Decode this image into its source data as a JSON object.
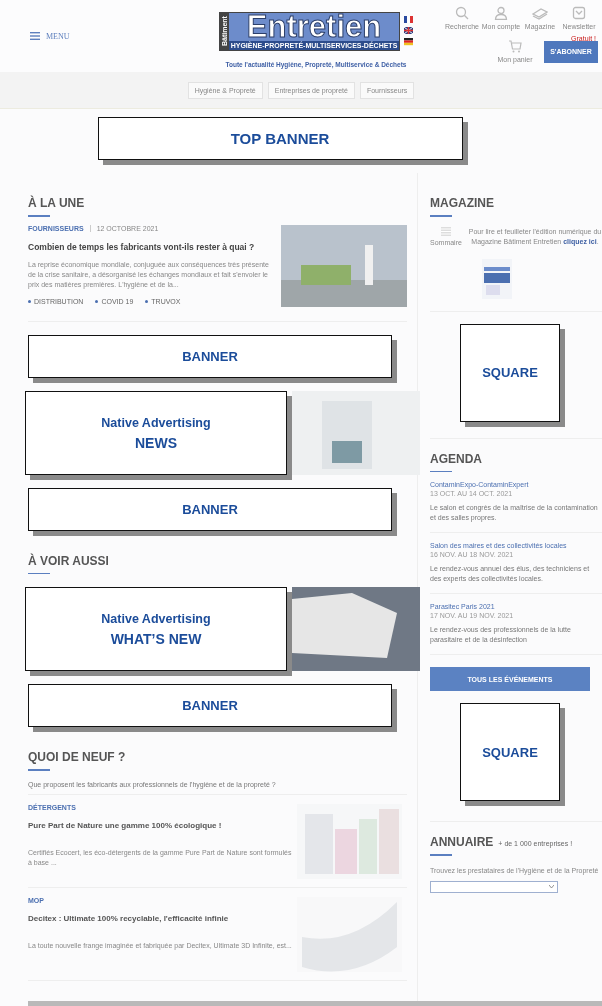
{
  "header": {
    "menu_label": "MENU",
    "logo": {
      "side_text": "Bâtiment",
      "title": "Entretien",
      "subtitle": "HYGIÈNE-PROPRETÉ-MULTISERVICES-DÉCHETS"
    },
    "tagline": "Toute l'actualité Hygiène, Propreté, Multiservice & Déchets",
    "icons": [
      {
        "kind": "search",
        "label": "Recherche"
      },
      {
        "kind": "account",
        "label": "Mon compte"
      },
      {
        "kind": "magazine",
        "label": "Magazine"
      },
      {
        "kind": "newsletter",
        "label": "Newsletter",
        "badge": "Gratuit !"
      }
    ],
    "cart_label": "Mon panier",
    "subscribe_button": "S'ABONNER"
  },
  "nav": [
    "Hygiène & Propreté",
    "Entreprises de propreté",
    "Fournisseurs"
  ],
  "top_banner": "TOP BANNER",
  "left_column": [
    {
      "kind": "heading",
      "text": "À LA UNE"
    },
    {
      "kind": "feature",
      "category": "FOURNISSEURS",
      "date": "12 OCTOBRE 2021",
      "title": "Combien de temps les fabricants vont-ils rester à quai ?",
      "excerpt": "La reprise économique mondiale, conjuguée aux conséquences très présente de la crise sanitaire, a désorganisé les échanges mondiaux et fait s'envoler le prix des matières premières. L'hygiène et de la...",
      "tags": [
        "DISTRIBUTION",
        "COVID 19",
        "TRUVOX"
      ]
    },
    {
      "kind": "banner",
      "label": "BANNER"
    },
    {
      "kind": "native",
      "lines": [
        "Native Advertising",
        "NEWS"
      ]
    },
    {
      "kind": "banner",
      "label": "BANNER"
    },
    {
      "kind": "heading",
      "text": "À VOIR AUSSI"
    },
    {
      "kind": "native",
      "lines": [
        "Native Advertising",
        "WHAT’S NEW"
      ]
    },
    {
      "kind": "banner",
      "label": "BANNER"
    },
    {
      "kind": "heading",
      "text": "QUOI DE NEUF ?",
      "subtitle": "Que proposent les fabricants aux professionnels de l'hygiène et de la propreté ?"
    },
    {
      "kind": "product",
      "category": "DÉTERGENTS",
      "title": "Pure Part de Nature une gamme 100% écologique !",
      "excerpt": "Certifiés Ecocert, les éco-détergents de la gamme Pure Part de Nature sont formulés à base ..."
    },
    {
      "kind": "product",
      "category": "MOP",
      "title": "Decitex : Ultimate 100% recyclable, l'efficacité infinie",
      "excerpt": "La toute nouvelle frange imaginée et fabriquée par Decitex, Ultimate 3D Infinite, est..."
    }
  ],
  "sidebar": [
    {
      "kind": "magazine",
      "heading": "MAGAZINE",
      "link_label": "Sommaire",
      "text": "Pour lire et feuilleter l'édition numérique du Magazine Bâtiment Entretien ",
      "link": "cliquez ici",
      "after": "."
    },
    {
      "kind": "square",
      "label": "SQUARE"
    },
    {
      "kind": "agenda",
      "heading": "AGENDA",
      "events": [
        {
          "title": "ContaminExpo-ContaminExpert",
          "date": "13 OCT. AU 14 OCT. 2021",
          "text": "Le salon et congrès de la maîtrise de la contamination et des salles propres."
        },
        {
          "title": "Salon des maires et des collectivités locales",
          "date": "16 NOV. AU 18 NOV. 2021",
          "text": "Le rendez-vous annuel des élus, des techniciens et des experts des collectivités locales."
        },
        {
          "title": "Parasitec Paris 2021",
          "date": "17 NOV. AU 19 NOV. 2021",
          "text": "Le rendez-vous des professionnels de la lutte parasitaire et de la désinfection"
        }
      ],
      "button": "TOUS LES ÉVÉNEMENTS"
    },
    {
      "kind": "square",
      "label": "SQUARE"
    },
    {
      "kind": "directory",
      "heading": "ANNUAIRE",
      "note": "+ de 1 000 entreprises !",
      "text": "Trouvez les prestataires de l'Hygiène et de la Propreté"
    }
  ]
}
